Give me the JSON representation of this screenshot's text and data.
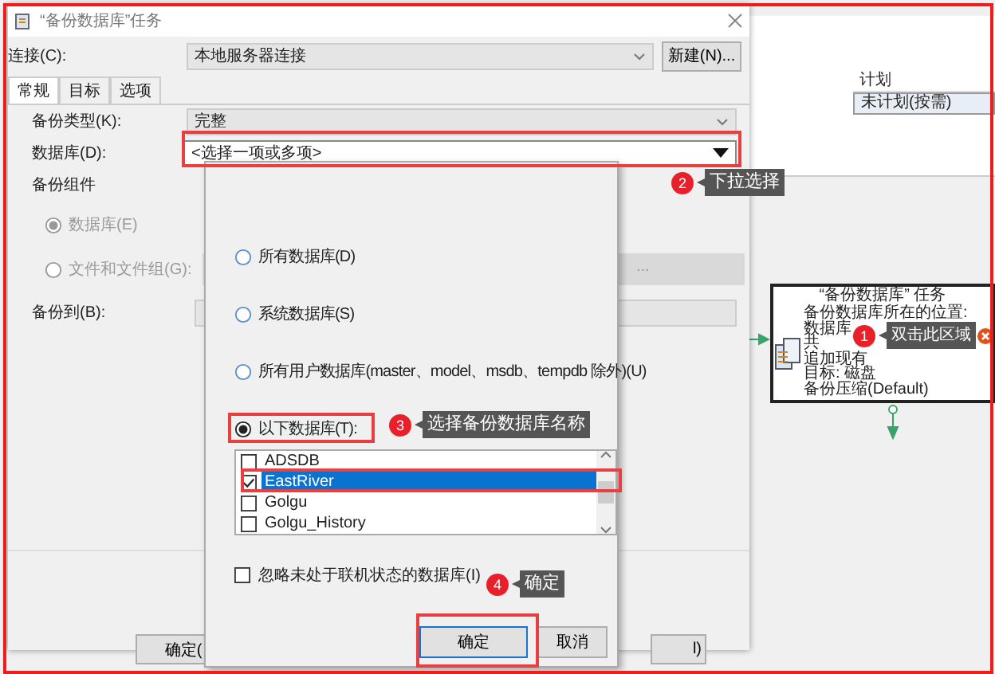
{
  "designer": {
    "schedule_header": "计划",
    "schedule_value": "未计划(按需)",
    "task": {
      "title": "“备份数据库” 任务",
      "lines": [
        "备份数据库所在的位置:",
        "数据库",
        "共",
        "追加现有",
        "目标: 磁盘",
        "备份压缩(Default)"
      ]
    }
  },
  "dialog": {
    "title": "“备份数据库”任务",
    "connection": {
      "label": "连接(C):",
      "value": "本地服务器连接"
    },
    "new_button": "新建(N)...",
    "tabs": [
      {
        "label": "常规",
        "selected": true
      },
      {
        "label": "目标",
        "selected": false
      },
      {
        "label": "选项",
        "selected": false
      }
    ],
    "backup_type": {
      "label": "备份类型(K):",
      "value": "完整"
    },
    "database": {
      "label": "数据库(D):",
      "value": "<选择一项或多项>"
    },
    "components_label": "备份组件",
    "components": [
      {
        "label": "数据库(E)",
        "selected": true,
        "disabled": true
      },
      {
        "label": "文件和文件组(G):",
        "selected": false,
        "disabled": true
      }
    ],
    "files_button": "...",
    "backup_to": {
      "label": "备份到(B):"
    },
    "footer_buttons": [
      "确定(",
      "l)"
    ]
  },
  "popup": {
    "options": [
      {
        "label": "所有数据库(D)",
        "selected": false
      },
      {
        "label": "系统数据库(S)",
        "selected": false
      },
      {
        "label": "所有用户数据库(master、model、msdb、tempdb 除外)(U)",
        "selected": false
      },
      {
        "label": "以下数据库(T):",
        "selected": true
      }
    ],
    "databases": [
      {
        "name": "ADSDB",
        "checked": false,
        "selected": false
      },
      {
        "name": "EastRiver",
        "checked": true,
        "selected": true
      },
      {
        "name": "Golgu",
        "checked": false,
        "selected": false
      },
      {
        "name": "Golgu_History",
        "checked": false,
        "selected": false
      }
    ],
    "ignore_offline": {
      "label": "忽略未处于联机状态的数据库(I)",
      "checked": false
    },
    "buttons": [
      "确定",
      "取消"
    ]
  },
  "callouts": [
    {
      "number": "1",
      "text": "双击此区域"
    },
    {
      "number": "2",
      "text": "下拉选择"
    },
    {
      "number": "3",
      "text": "选择备份数据库名称"
    },
    {
      "number": "4",
      "text": "确定"
    }
  ]
}
